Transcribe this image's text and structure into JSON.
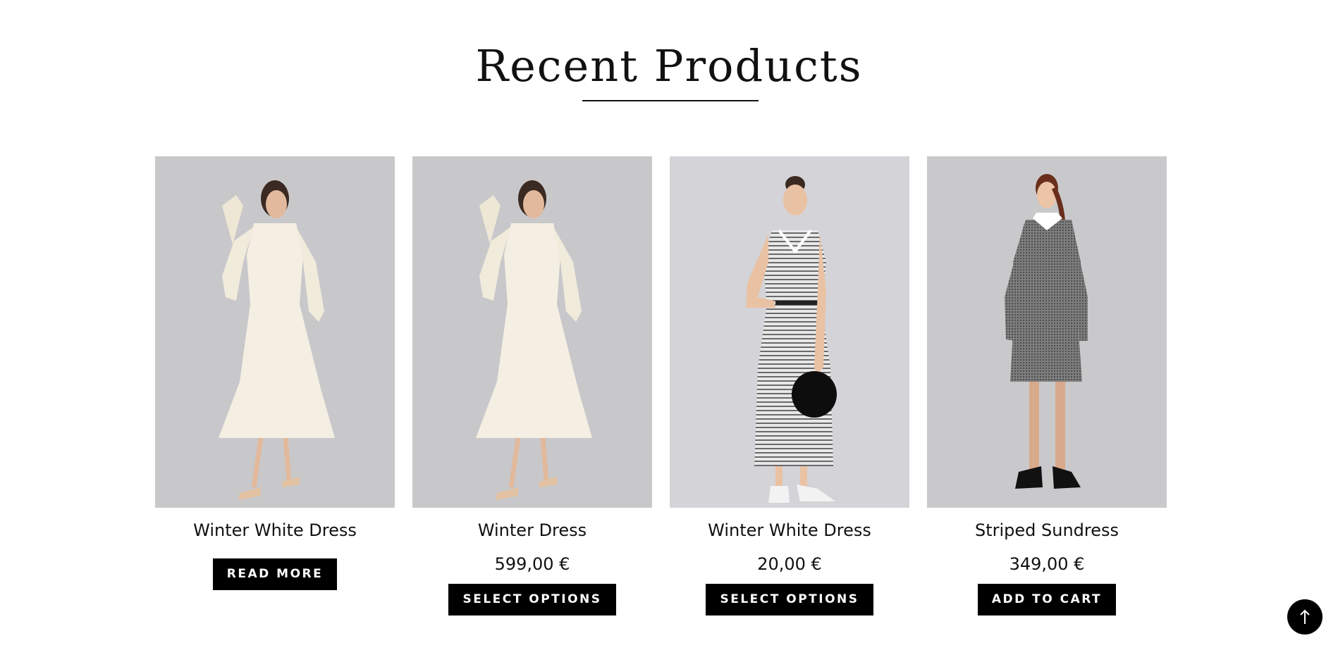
{
  "section": {
    "title": "Recent Products"
  },
  "products": [
    {
      "name": "Winter White Dress",
      "price": "",
      "button_label": "READ MORE",
      "image_icon": "model-white-dress-image"
    },
    {
      "name": "Winter Dress",
      "price": "599,00 €",
      "button_label": "SELECT OPTIONS",
      "image_icon": "model-white-dress-image"
    },
    {
      "name": "Winter White Dress",
      "price": "20,00 €",
      "button_label": "SELECT OPTIONS",
      "image_icon": "model-striped-dress-image"
    },
    {
      "name": "Striped Sundress",
      "price": "349,00 €",
      "button_label": "ADD TO CART",
      "image_icon": "model-grey-dress-image"
    }
  ],
  "back_to_top": {
    "icon": "arrow-up-icon"
  },
  "colors": {
    "button_bg": "#000000",
    "button_text": "#ffffff",
    "image_bg": "#c9c9cc"
  }
}
